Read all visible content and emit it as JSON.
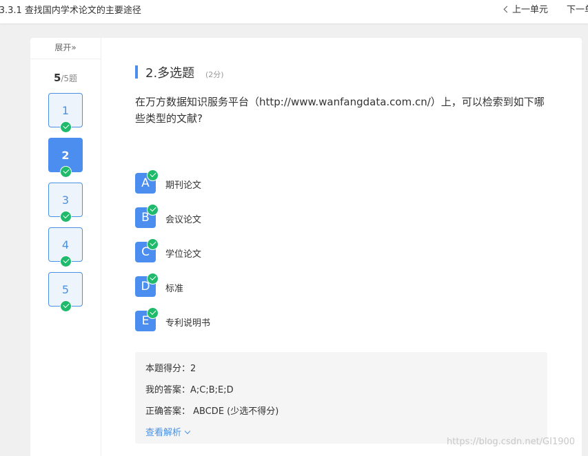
{
  "topbar": {
    "title": "-3.3.1 查找国内学术论文的主要途径",
    "prev_label": "上一单元",
    "next_label": "下一单"
  },
  "sidebar": {
    "expand_label": "展开»",
    "progress_current": "5",
    "progress_total": "/5题",
    "questions": [
      {
        "num": "1",
        "answered": true
      },
      {
        "num": "2",
        "answered": true,
        "active": true
      },
      {
        "num": "3",
        "answered": true
      },
      {
        "num": "4",
        "answered": true
      },
      {
        "num": "5",
        "answered": true
      }
    ]
  },
  "question": {
    "title": "2.多选题",
    "score": "(2分)",
    "text": "在万方数据知识服务平台（http://www.wanfangdata.com.cn/）上，可以检索到如下哪些类型的文献?",
    "options": [
      {
        "letter": "A",
        "text": "期刊论文"
      },
      {
        "letter": "B",
        "text": "会议论文"
      },
      {
        "letter": "C",
        "text": "学位论文"
      },
      {
        "letter": "D",
        "text": "标准"
      },
      {
        "letter": "E",
        "text": "专利说明书"
      }
    ]
  },
  "result": {
    "score_label": "本题得分：",
    "score_value": "2",
    "my_answer_label": "我的答案：",
    "my_answer_value": "A;C;B;E;D",
    "correct_label": "正确答案：",
    "correct_value": " ABCDE (少选不得分)",
    "view_analysis": "查看解析"
  },
  "watermark": "https://blog.csdn.net/GI1900",
  "colors": {
    "accent": "#4b8ef0",
    "check": "#1fba6b"
  }
}
